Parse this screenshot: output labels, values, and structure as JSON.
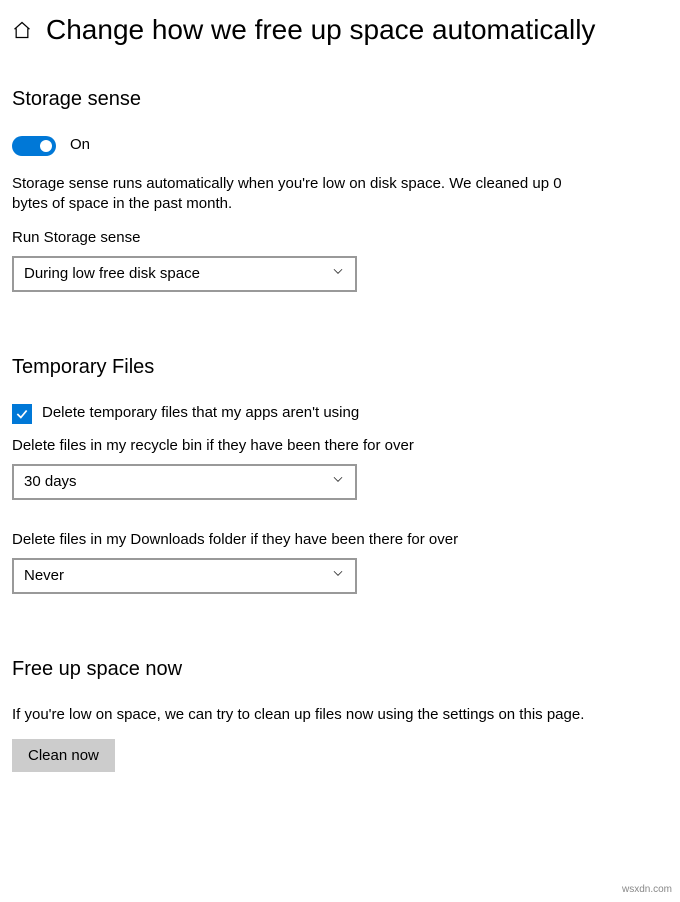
{
  "title": "Change how we free up space automatically",
  "storage_sense": {
    "heading": "Storage sense",
    "toggle_label": "On",
    "description": "Storage sense runs automatically when you're low on disk space. We cleaned up 0 bytes of space in the past month.",
    "run_label": "Run Storage sense",
    "run_value": "During low free disk space"
  },
  "temp_files": {
    "heading": "Temporary Files",
    "delete_unused_label": "Delete temporary files that my apps aren't using",
    "recycle_label": "Delete files in my recycle bin if they have been there for over",
    "recycle_value": "30 days",
    "downloads_label": "Delete files in my Downloads folder if they have been there for over",
    "downloads_value": "Never"
  },
  "free_up": {
    "heading": "Free up space now",
    "description": "If you're low on space, we can try to clean up files now using the settings on this page.",
    "button": "Clean now"
  },
  "watermark": "wsxdn.com"
}
